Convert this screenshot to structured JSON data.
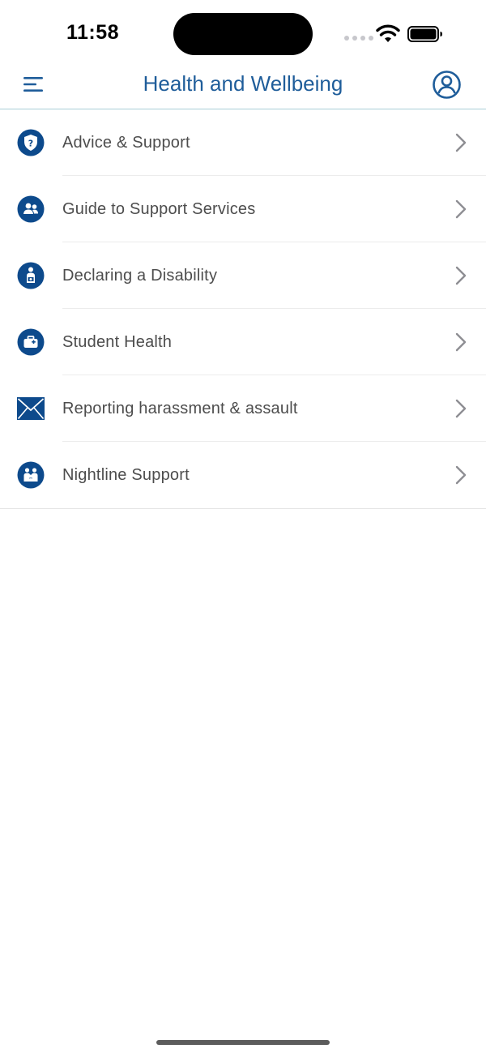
{
  "status_bar": {
    "time": "11:58"
  },
  "header": {
    "title": "Health and Wellbeing",
    "menu_icon": "hamburger-menu-icon",
    "profile_icon": "user-profile-icon"
  },
  "colors": {
    "brand_blue": "#1f5d9a",
    "icon_blue": "#0d4a8c",
    "header_divider": "#a9cfd6",
    "label_gray": "#4d4d4d",
    "chevron_gray": "#8e8e93"
  },
  "menu": {
    "items": [
      {
        "label": "Advice & Support",
        "icon": "shield-question-icon"
      },
      {
        "label": "Guide to Support Services",
        "icon": "people-group-icon"
      },
      {
        "label": "Declaring a Disability",
        "icon": "disability-person-icon"
      },
      {
        "label": "Student Health",
        "icon": "medical-bag-icon"
      },
      {
        "label": "Reporting harassment & assault",
        "icon": "envelope-icon"
      },
      {
        "label": "Nightline Support",
        "icon": "family-support-icon"
      }
    ]
  }
}
